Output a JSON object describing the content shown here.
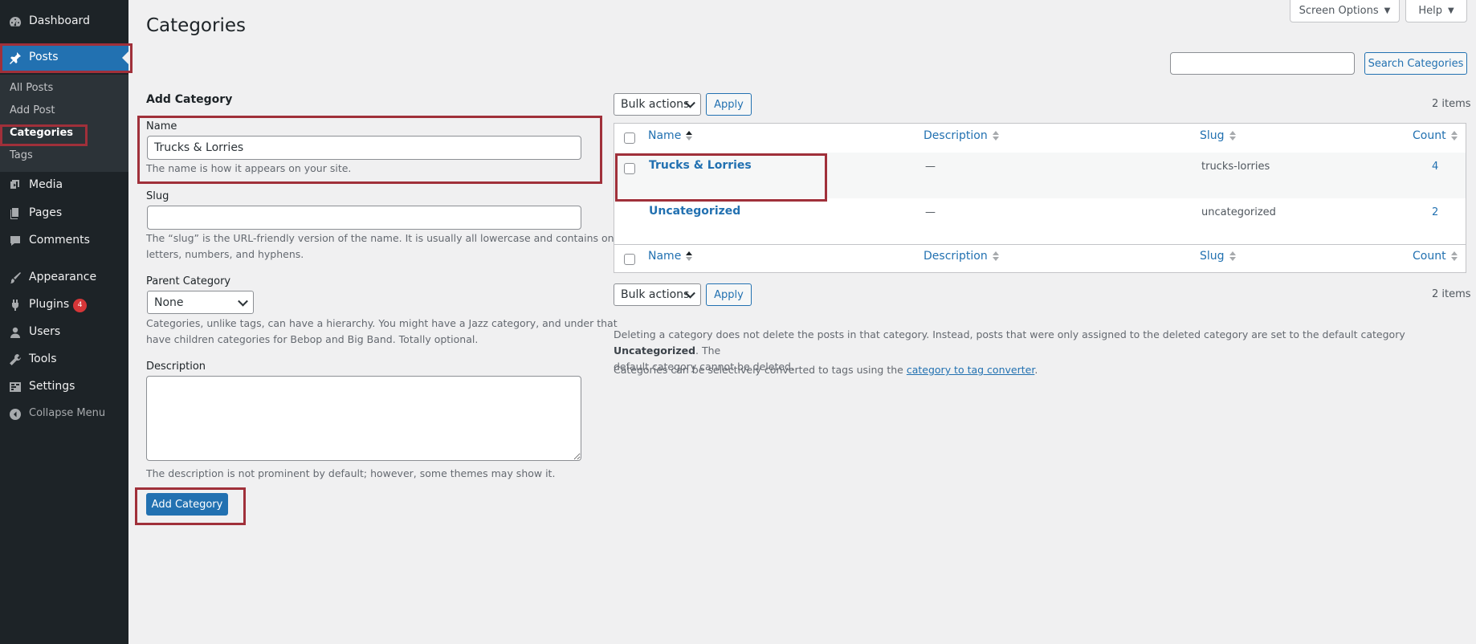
{
  "sidebar": {
    "menu": [
      {
        "label": "Dashboard",
        "icon": "dashboard-icon"
      },
      {
        "label": "Posts",
        "icon": "pin-icon"
      },
      {
        "label": "Media",
        "icon": "media-icon"
      },
      {
        "label": "Pages",
        "icon": "pages-icon"
      },
      {
        "label": "Comments",
        "icon": "comments-icon"
      },
      {
        "label": "Appearance",
        "icon": "brush-icon"
      },
      {
        "label": "Plugins",
        "icon": "plugin-icon",
        "badge": "4"
      },
      {
        "label": "Users",
        "icon": "user-icon"
      },
      {
        "label": "Tools",
        "icon": "wrench-icon"
      },
      {
        "label": "Settings",
        "icon": "settings-icon"
      }
    ],
    "submenu": [
      {
        "label": "All Posts"
      },
      {
        "label": "Add Post"
      },
      {
        "label": "Categories"
      },
      {
        "label": "Tags"
      }
    ],
    "collapse_label": "Collapse Menu"
  },
  "header": {
    "page_title": "Categories",
    "screen_options": "Screen Options",
    "help": "Help"
  },
  "search": {
    "value": "",
    "button": "Search Categories"
  },
  "form": {
    "heading": "Add Category",
    "name_label": "Name",
    "name_value": "Trucks & Lorries",
    "name_help": "The name is how it appears on your site.",
    "slug_label": "Slug",
    "slug_value": "",
    "slug_help_1": "The “slug” is the URL-friendly version of the name. It is usually all lowercase and contains only",
    "slug_help_2": "letters, numbers, and hyphens.",
    "parent_label": "Parent Category",
    "parent_value": "None",
    "parent_help_1": "Categories, unlike tags, can have a hierarchy. You might have a Jazz category, and under that",
    "parent_help_2": "have children categories for Bebop and Big Band. Totally optional.",
    "description_label": "Description",
    "description_value": "",
    "description_help": "The description is not prominent by default; however, some themes may show it.",
    "submit": "Add Category"
  },
  "table": {
    "bulk_actions": "Bulk actions",
    "apply": "Apply",
    "items_count": "2 items",
    "columns": {
      "name": "Name",
      "description": "Description",
      "slug": "Slug",
      "count": "Count"
    },
    "rows": [
      {
        "name": "Trucks & Lorries",
        "description": "—",
        "slug": "trucks-lorries",
        "count": "4"
      },
      {
        "name": "Uncategorized",
        "description": "—",
        "slug": "uncategorized",
        "count": "2"
      }
    ]
  },
  "notes": {
    "note1_a": "Deleting a category does not delete the posts in that category. Instead, posts that were only assigned to the deleted category are set to the default category",
    "note1_bold": "Uncategorized",
    "note1_b": ". The",
    "note1_c": "default category cannot be deleted.",
    "note2_a": "Categories can be selectively converted to tags using the",
    "note2_link": "category to tag converter",
    "note2_b": "."
  }
}
